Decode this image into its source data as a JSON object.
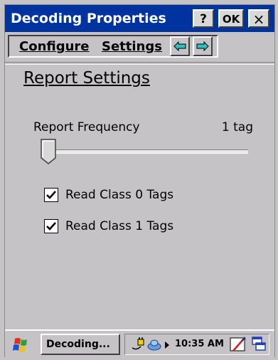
{
  "window": {
    "title": "Decoding Properties",
    "help_label": "?",
    "ok_label": "OK",
    "close_label": "×"
  },
  "menu": {
    "items": [
      {
        "label": "Configure"
      },
      {
        "label": "Settings"
      }
    ],
    "back_icon": "arrow-left-icon",
    "forward_icon": "arrow-right-icon"
  },
  "page": {
    "title": "Report Settings",
    "report_frequency": {
      "label": "Report Frequency",
      "value_text": "1 tag",
      "slider_level": 0
    },
    "checkboxes": [
      {
        "label": "Read Class 0 Tags",
        "checked": true
      },
      {
        "label": "Read Class 1 Tags",
        "checked": true
      }
    ]
  },
  "taskbar": {
    "start_icon": "windows-logo-icon",
    "task_label": "Decoding...",
    "tray_icons": [
      "power-plug-icon",
      "network-icon",
      "arrow-icon"
    ],
    "time": "10:35 AM",
    "end_icons": [
      "pen-input-icon",
      "window-switch-icon"
    ]
  },
  "colors": {
    "title_bar": "#0033a0",
    "background": "#c6c3c6"
  }
}
